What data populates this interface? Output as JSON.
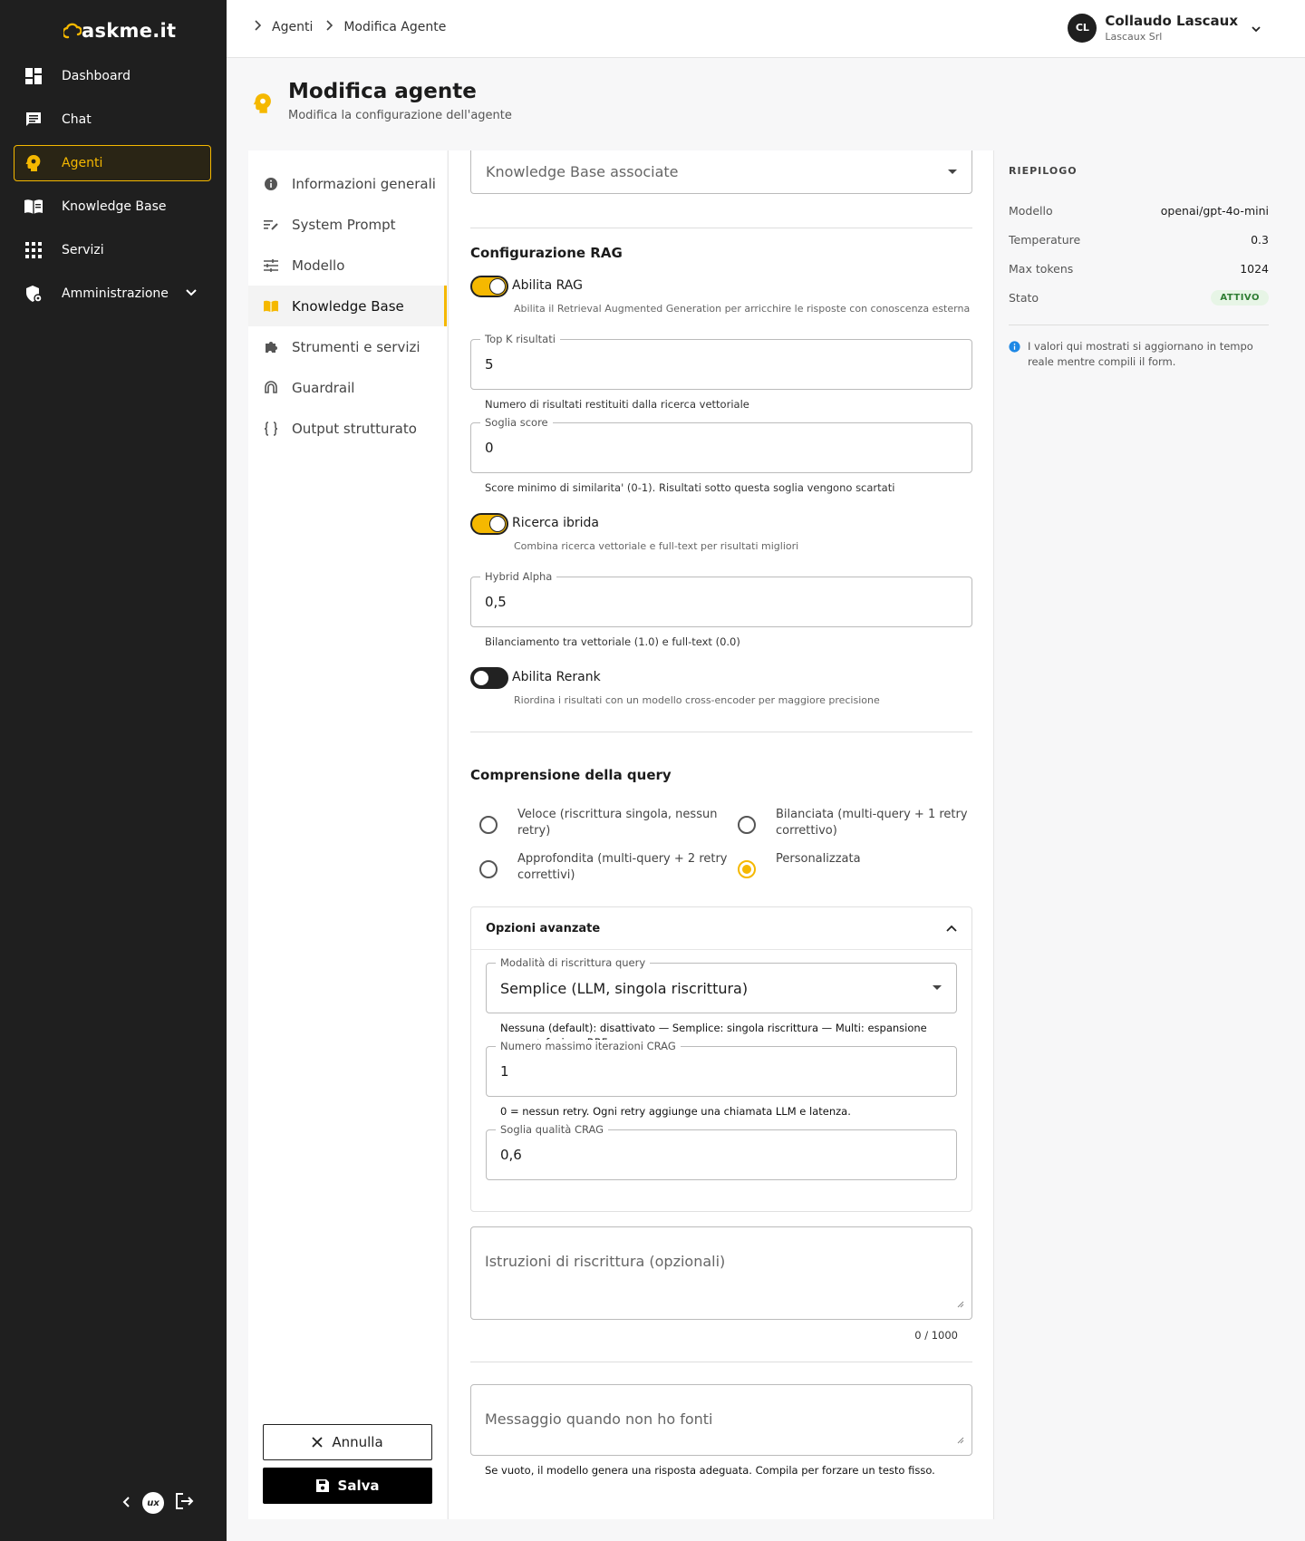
{
  "app": {
    "logo_text": "askme.it"
  },
  "sidebar": {
    "items": [
      {
        "label": "Dashboard",
        "icon": "dashboard-icon"
      },
      {
        "label": "Chat",
        "icon": "chat-icon"
      },
      {
        "label": "Agenti",
        "icon": "agent-icon",
        "active": true
      },
      {
        "label": "Knowledge Base",
        "icon": "book-icon"
      },
      {
        "label": "Servizi",
        "icon": "grid-icon"
      },
      {
        "label": "Amministrazione",
        "icon": "admin-shield-icon",
        "expandable": true
      }
    ],
    "bottom_badge": "ux"
  },
  "breadcrumb": {
    "items": [
      "Agenti",
      "Modifica Agente"
    ]
  },
  "user": {
    "initials": "CL",
    "name": "Collaudo Lascaux",
    "company": "Lascaux Srl"
  },
  "page": {
    "title": "Modifica agente",
    "subtitle": "Modifica la configurazione dell'agente"
  },
  "sections": {
    "items": [
      {
        "label": "Informazioni generali",
        "icon": "info-icon"
      },
      {
        "label": "System Prompt",
        "icon": "prompt-icon"
      },
      {
        "label": "Modello",
        "icon": "sliders-icon"
      },
      {
        "label": "Knowledge Base",
        "icon": "book-icon",
        "active": true
      },
      {
        "label": "Strumenti e servizi",
        "icon": "puzzle-icon"
      },
      {
        "label": "Guardrail",
        "icon": "guardrail-icon"
      },
      {
        "label": "Output strutturato",
        "icon": "braces-icon"
      }
    ],
    "cancel_label": "Annulla",
    "save_label": "Salva"
  },
  "form": {
    "kb_select_placeholder": "Knowledge Base associate",
    "rag_title": "Configurazione RAG",
    "enable_rag": {
      "label": "Abilita RAG",
      "help": "Abilita il Retrieval Augmented Generation per arricchire le risposte con conoscenza esterna",
      "on": true
    },
    "top_k": {
      "label": "Top K risultati",
      "value": "5",
      "help": "Numero di risultati restituiti dalla ricerca vettoriale"
    },
    "score": {
      "label": "Soglia score",
      "value": "0",
      "help": "Score minimo di similarita' (0-1). Risultati sotto questa soglia vengono scartati"
    },
    "hybrid": {
      "label": "Ricerca ibrida",
      "help": "Combina ricerca vettoriale e full-text per risultati migliori",
      "on": true
    },
    "alpha": {
      "label": "Hybrid Alpha",
      "value": "0,5",
      "help": "Bilanciamento tra vettoriale (1.0) e full-text (0.0)"
    },
    "rerank": {
      "label": "Abilita Rerank",
      "help": "Riordina i risultati con un modello cross-encoder per maggiore precisione",
      "on": false
    },
    "query_title": "Comprensione della query",
    "query_modes": [
      {
        "label": "Veloce (riscrittura singola, nessun retry)",
        "checked": false
      },
      {
        "label": "Bilanciata (multi-query + 1 retry correttivo)",
        "checked": false
      },
      {
        "label": "Approfondita (multi-query + 2 retry correttivi)",
        "checked": false
      },
      {
        "label": "Personalizzata",
        "checked": true
      }
    ],
    "advanced": {
      "title": "Opzioni avanzate",
      "rewrite_mode": {
        "label": "Modalità di riscrittura query",
        "value": "Semplice (LLM, singola riscrittura)",
        "help": "Nessuna (default): disattivato — Semplice: singola riscrittura — Multi: espansione query + fusione RRF"
      },
      "crag_iter": {
        "label": "Numero massimo iterazioni CRAG",
        "value": "1",
        "help": "0 = nessun retry. Ogni retry aggiunge una chiamata LLM e latenza."
      },
      "crag_quality": {
        "label": "Soglia qualità CRAG",
        "value": "0,6"
      }
    },
    "rewrite_instructions": {
      "placeholder": "Istruzioni di riscrittura (opzionali)",
      "counter": "0 / 1000"
    },
    "no_sources": {
      "placeholder": "Messaggio quando non ho fonti",
      "help": "Se vuoto, il modello genera una risposta adeguata. Compila per forzare un testo fisso."
    }
  },
  "summary": {
    "title": "RIEPILOGO",
    "rows": [
      {
        "key": "Modello",
        "value": "openai/gpt-4o-mini"
      },
      {
        "key": "Temperature",
        "value": "0.3"
      },
      {
        "key": "Max tokens",
        "value": "1024"
      },
      {
        "key": "Stato",
        "value": "ATTIVO"
      }
    ],
    "note": "I valori qui mostrati si aggiornano in tempo reale mentre compili il form."
  },
  "colors": {
    "accent": "#f5b800",
    "sidebar_bg": "#1f1f1f",
    "status_green": "#2e7d32"
  }
}
